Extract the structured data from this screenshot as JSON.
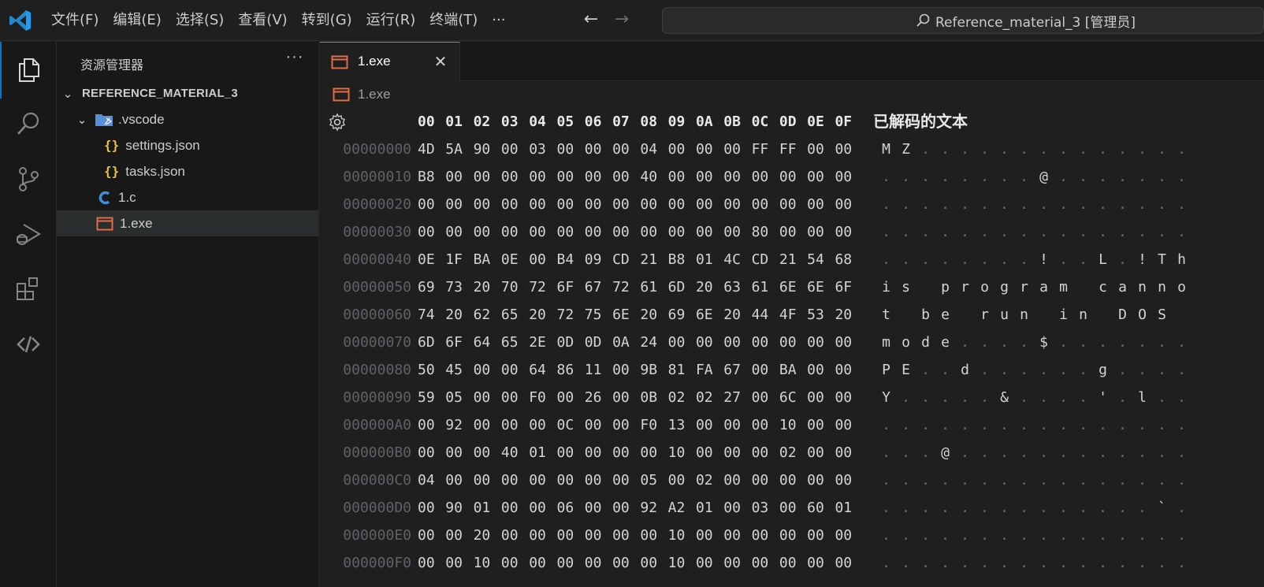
{
  "titlebar": {
    "menus": [
      "文件(F)",
      "编辑(E)",
      "选择(S)",
      "查看(V)",
      "转到(G)",
      "运行(R)",
      "终端(T)",
      "···"
    ],
    "back_icon": "←",
    "forward_icon": "→",
    "command_center": "Reference_material_3 [管理员]"
  },
  "activitybar": {
    "items": [
      "explorer-icon",
      "search-icon",
      "source-control-icon",
      "run-debug-icon",
      "extensions-icon",
      "remote-icon"
    ]
  },
  "sidebar": {
    "title": "资源管理器",
    "more": "···",
    "root": "REFERENCE_MATERIAL_3",
    "items": [
      {
        "label": ".vscode",
        "kind": "folder"
      },
      {
        "label": "settings.json",
        "kind": "json"
      },
      {
        "label": "tasks.json",
        "kind": "json"
      },
      {
        "label": "1.c",
        "kind": "c"
      },
      {
        "label": "1.exe",
        "kind": "exe"
      }
    ]
  },
  "editor": {
    "tab_label": "1.exe",
    "tab_close": "✕",
    "breadcrumb": "1.exe",
    "hex_header": [
      "00",
      "01",
      "02",
      "03",
      "04",
      "05",
      "06",
      "07",
      "08",
      "09",
      "0A",
      "0B",
      "0C",
      "0D",
      "0E",
      "0F"
    ],
    "decoded_title": "已解码的文本",
    "rows": [
      {
        "addr": "00000000",
        "bytes": [
          "4D",
          "5A",
          "90",
          "00",
          "03",
          "00",
          "00",
          "00",
          "04",
          "00",
          "00",
          "00",
          "FF",
          "FF",
          "00",
          "00"
        ],
        "text": [
          "M",
          "Z",
          ".",
          ".",
          ".",
          ".",
          ".",
          ".",
          ".",
          ".",
          ".",
          ".",
          ".",
          ".",
          ".",
          "."
        ]
      },
      {
        "addr": "00000010",
        "bytes": [
          "B8",
          "00",
          "00",
          "00",
          "00",
          "00",
          "00",
          "00",
          "40",
          "00",
          "00",
          "00",
          "00",
          "00",
          "00",
          "00"
        ],
        "text": [
          ".",
          ".",
          ".",
          ".",
          ".",
          ".",
          ".",
          ".",
          "@",
          ".",
          ".",
          ".",
          ".",
          ".",
          ".",
          "."
        ]
      },
      {
        "addr": "00000020",
        "bytes": [
          "00",
          "00",
          "00",
          "00",
          "00",
          "00",
          "00",
          "00",
          "00",
          "00",
          "00",
          "00",
          "00",
          "00",
          "00",
          "00"
        ],
        "text": [
          ".",
          ".",
          ".",
          ".",
          ".",
          ".",
          ".",
          ".",
          ".",
          ".",
          ".",
          ".",
          ".",
          ".",
          ".",
          "."
        ]
      },
      {
        "addr": "00000030",
        "bytes": [
          "00",
          "00",
          "00",
          "00",
          "00",
          "00",
          "00",
          "00",
          "00",
          "00",
          "00",
          "00",
          "80",
          "00",
          "00",
          "00"
        ],
        "text": [
          ".",
          ".",
          ".",
          ".",
          ".",
          ".",
          ".",
          ".",
          ".",
          ".",
          ".",
          ".",
          ".",
          ".",
          ".",
          "."
        ]
      },
      {
        "addr": "00000040",
        "bytes": [
          "0E",
          "1F",
          "BA",
          "0E",
          "00",
          "B4",
          "09",
          "CD",
          "21",
          "B8",
          "01",
          "4C",
          "CD",
          "21",
          "54",
          "68"
        ],
        "text": [
          ".",
          ".",
          ".",
          ".",
          ".",
          ".",
          ".",
          ".",
          "!",
          ".",
          ".",
          "L",
          ".",
          "!",
          "T",
          "h"
        ]
      },
      {
        "addr": "00000050",
        "bytes": [
          "69",
          "73",
          "20",
          "70",
          "72",
          "6F",
          "67",
          "72",
          "61",
          "6D",
          "20",
          "63",
          "61",
          "6E",
          "6E",
          "6F"
        ],
        "text": [
          "i",
          "s",
          " ",
          "p",
          "r",
          "o",
          "g",
          "r",
          "a",
          "m",
          " ",
          "c",
          "a",
          "n",
          "n",
          "o"
        ]
      },
      {
        "addr": "00000060",
        "bytes": [
          "74",
          "20",
          "62",
          "65",
          "20",
          "72",
          "75",
          "6E",
          "20",
          "69",
          "6E",
          "20",
          "44",
          "4F",
          "53",
          "20"
        ],
        "text": [
          "t",
          " ",
          "b",
          "e",
          " ",
          "r",
          "u",
          "n",
          " ",
          "i",
          "n",
          " ",
          "D",
          "O",
          "S",
          " "
        ]
      },
      {
        "addr": "00000070",
        "bytes": [
          "6D",
          "6F",
          "64",
          "65",
          "2E",
          "0D",
          "0D",
          "0A",
          "24",
          "00",
          "00",
          "00",
          "00",
          "00",
          "00",
          "00"
        ],
        "text": [
          "m",
          "o",
          "d",
          "e",
          ".",
          ".",
          ".",
          ".",
          "$",
          ".",
          ".",
          ".",
          ".",
          ".",
          ".",
          "."
        ]
      },
      {
        "addr": "00000080",
        "bytes": [
          "50",
          "45",
          "00",
          "00",
          "64",
          "86",
          "11",
          "00",
          "9B",
          "81",
          "FA",
          "67",
          "00",
          "BA",
          "00",
          "00"
        ],
        "text": [
          "P",
          "E",
          ".",
          ".",
          "d",
          ".",
          ".",
          ".",
          ".",
          ".",
          ".",
          "g",
          ".",
          ".",
          ".",
          "."
        ]
      },
      {
        "addr": "00000090",
        "bytes": [
          "59",
          "05",
          "00",
          "00",
          "F0",
          "00",
          "26",
          "00",
          "0B",
          "02",
          "02",
          "27",
          "00",
          "6C",
          "00",
          "00"
        ],
        "text": [
          "Y",
          ".",
          ".",
          ".",
          ".",
          ".",
          "&",
          ".",
          ".",
          ".",
          ".",
          "'",
          ".",
          "l",
          ".",
          "."
        ]
      },
      {
        "addr": "000000A0",
        "bytes": [
          "00",
          "92",
          "00",
          "00",
          "00",
          "0C",
          "00",
          "00",
          "F0",
          "13",
          "00",
          "00",
          "00",
          "10",
          "00",
          "00"
        ],
        "text": [
          ".",
          ".",
          ".",
          ".",
          ".",
          ".",
          ".",
          ".",
          ".",
          ".",
          ".",
          ".",
          ".",
          ".",
          ".",
          "."
        ]
      },
      {
        "addr": "000000B0",
        "bytes": [
          "00",
          "00",
          "00",
          "40",
          "01",
          "00",
          "00",
          "00",
          "00",
          "10",
          "00",
          "00",
          "00",
          "02",
          "00",
          "00"
        ],
        "text": [
          ".",
          ".",
          ".",
          "@",
          ".",
          ".",
          ".",
          ".",
          ".",
          ".",
          ".",
          ".",
          ".",
          ".",
          ".",
          "."
        ]
      },
      {
        "addr": "000000C0",
        "bytes": [
          "04",
          "00",
          "00",
          "00",
          "00",
          "00",
          "00",
          "00",
          "05",
          "00",
          "02",
          "00",
          "00",
          "00",
          "00",
          "00"
        ],
        "text": [
          ".",
          ".",
          ".",
          ".",
          ".",
          ".",
          ".",
          ".",
          ".",
          ".",
          ".",
          ".",
          ".",
          ".",
          ".",
          "."
        ]
      },
      {
        "addr": "000000D0",
        "bytes": [
          "00",
          "90",
          "01",
          "00",
          "00",
          "06",
          "00",
          "00",
          "92",
          "A2",
          "01",
          "00",
          "03",
          "00",
          "60",
          "01"
        ],
        "text": [
          ".",
          ".",
          ".",
          ".",
          ".",
          ".",
          ".",
          ".",
          ".",
          ".",
          ".",
          ".",
          ".",
          ".",
          "`",
          "."
        ]
      },
      {
        "addr": "000000E0",
        "bytes": [
          "00",
          "00",
          "20",
          "00",
          "00",
          "00",
          "00",
          "00",
          "00",
          "10",
          "00",
          "00",
          "00",
          "00",
          "00",
          "00"
        ],
        "text": [
          ".",
          ".",
          ".",
          ".",
          ".",
          ".",
          ".",
          ".",
          ".",
          ".",
          ".",
          ".",
          ".",
          ".",
          ".",
          "."
        ]
      },
      {
        "addr": "000000F0",
        "bytes": [
          "00",
          "00",
          "10",
          "00",
          "00",
          "00",
          "00",
          "00",
          "00",
          "10",
          "00",
          "00",
          "00",
          "00",
          "00",
          "00"
        ],
        "text": [
          ".",
          ".",
          ".",
          ".",
          ".",
          ".",
          ".",
          ".",
          ".",
          ".",
          ".",
          ".",
          ".",
          ".",
          ".",
          "."
        ]
      }
    ]
  },
  "colors": {
    "accent": "#0078d4",
    "exe_icon": "#e06c4a",
    "json_icon": "#f1c232",
    "c_icon": "#3d8fd6",
    "folder_icon": "#5a8fd8"
  }
}
